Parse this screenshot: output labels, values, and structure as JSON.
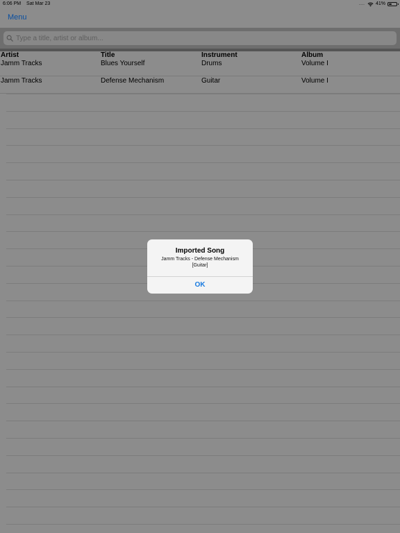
{
  "status_bar": {
    "time": "6:06 PM",
    "date": "Sat Mar 23",
    "signal": ".....",
    "battery": "41%",
    "battery_level": 0.41
  },
  "nav": {
    "menu_label": "Menu"
  },
  "search": {
    "placeholder": "Type a title, artist or album..."
  },
  "table": {
    "headers": [
      "Artist",
      "Title",
      "Instrument",
      "Album"
    ],
    "rows": [
      {
        "artist": "Jamm Tracks",
        "title": "Blues Yourself",
        "instrument": "Drums",
        "album": "Volume I"
      },
      {
        "artist": "Jamm Tracks",
        "title": "Defense Mechanism",
        "instrument": "Guitar",
        "album": "Volume I"
      }
    ]
  },
  "alert": {
    "title": "Imported Song",
    "message_line1": "Jamm Tracks  - Defense Mechanism",
    "message_line2": "[Guitar]",
    "ok_label": "OK"
  },
  "colors": {
    "accent": "#1a7be0",
    "nav_link": "#0a4fa0",
    "dimmed_background": "#8c8c8c"
  }
}
